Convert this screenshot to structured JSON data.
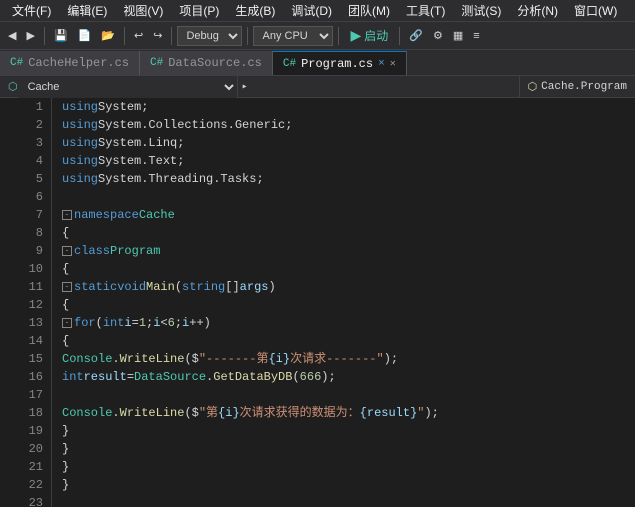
{
  "menubar": {
    "items": [
      "文件(F)",
      "编辑(E)",
      "视图(V)",
      "项目(P)",
      "生成(B)",
      "调试(D)",
      "团队(M)",
      "工具(T)",
      "测试(S)",
      "分析(N)",
      "窗口(W)"
    ]
  },
  "toolbar": {
    "debug_label": "Debug",
    "cpu_label": "Any CPU",
    "start_label": "启动",
    "icons": [
      "back",
      "forward",
      "undo",
      "redo",
      "save",
      "new",
      "open"
    ]
  },
  "tabs": [
    {
      "label": "CacheHelper.cs",
      "active": false,
      "icon": "cs"
    },
    {
      "label": "DataSource.cs",
      "active": false,
      "icon": "cs"
    },
    {
      "label": "Program.cs",
      "active": true,
      "icon": "cs",
      "modified": true
    }
  ],
  "navstrip": {
    "left_label": "Cache",
    "right_label": "Cache.Program"
  },
  "code": {
    "lines": [
      {
        "num": 1,
        "indent": 0,
        "content": "using System;"
      },
      {
        "num": 2,
        "indent": 0,
        "content": "using System.Collections.Generic;"
      },
      {
        "num": 3,
        "indent": 0,
        "content": "using System.Linq;"
      },
      {
        "num": 4,
        "indent": 0,
        "content": "using System.Text;"
      },
      {
        "num": 5,
        "indent": 0,
        "content": "using System.Threading.Tasks;"
      },
      {
        "num": 6,
        "indent": 0,
        "content": ""
      },
      {
        "num": 7,
        "indent": 0,
        "content": "namespace Cache"
      },
      {
        "num": 8,
        "indent": 0,
        "content": "{"
      },
      {
        "num": 9,
        "indent": 1,
        "content": "class Program"
      },
      {
        "num": 10,
        "indent": 1,
        "content": "{"
      },
      {
        "num": 11,
        "indent": 2,
        "content": "static void Main(string[] args)"
      },
      {
        "num": 12,
        "indent": 2,
        "content": "{"
      },
      {
        "num": 13,
        "indent": 3,
        "content": "for (int i = 1; i < 6; i++)"
      },
      {
        "num": 14,
        "indent": 3,
        "content": "{"
      },
      {
        "num": 15,
        "indent": 4,
        "content": "Console.WriteLine($\"-------第{i}次请求-------\");"
      },
      {
        "num": 16,
        "indent": 4,
        "content": "int result = DataSource.GetDataByDB(666);"
      },
      {
        "num": 17,
        "indent": 4,
        "content": ""
      },
      {
        "num": 18,
        "indent": 4,
        "content": "Console.WriteLine($\"第{i}次请求获得的数据为：{result}\");"
      },
      {
        "num": 19,
        "indent": 3,
        "content": "}"
      },
      {
        "num": 20,
        "indent": 2,
        "content": "}"
      },
      {
        "num": 21,
        "indent": 1,
        "content": "}"
      },
      {
        "num": 22,
        "indent": 0,
        "content": "}"
      },
      {
        "num": 23,
        "indent": 0,
        "content": ""
      }
    ]
  }
}
